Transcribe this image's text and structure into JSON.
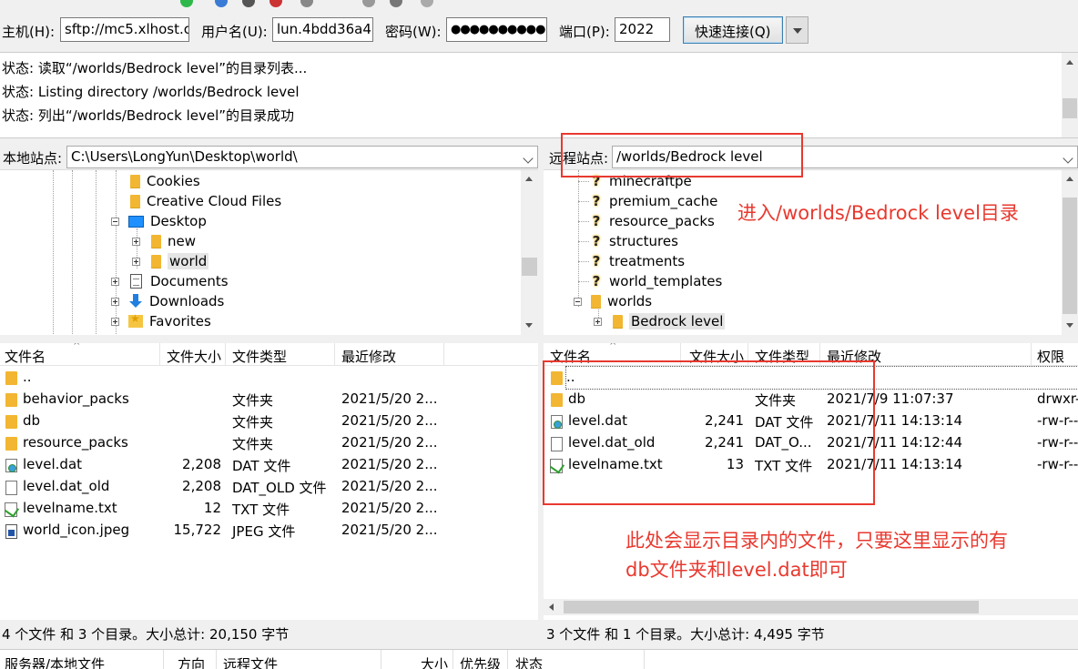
{
  "quickconnect": {
    "host_label": "主机(H):",
    "host_value": "sftp://mc5.xlhost.c",
    "user_label": "用户名(U):",
    "user_value": "lun.4bdd36a4",
    "pass_label": "密码(W):",
    "pass_value": "●●●●●●●●●●",
    "port_label": "端口(P):",
    "port_value": "2022",
    "connect_button": "快速连接(Q)"
  },
  "log": [
    "状态:  读取“/worlds/Bedrock level”的目录列表...",
    "状态:  Listing directory /worlds/Bedrock level",
    "状态:  列出“/worlds/Bedrock level”的目录成功"
  ],
  "local": {
    "site_label": "本地站点:",
    "site_path": "C:\\Users\\LongYun\\Desktop\\world\\",
    "tree": {
      "cookies": "Cookies",
      "creative_cloud": "Creative Cloud Files",
      "desktop": "Desktop",
      "new": "new",
      "world": "world",
      "documents": "Documents",
      "downloads": "Downloads",
      "favorites": "Favorites"
    },
    "columns": {
      "name": "文件名",
      "size": "文件大小",
      "type": "文件类型",
      "modified": "最近修改"
    },
    "files": [
      {
        "name": "..",
        "size": "",
        "type": "",
        "modified": ""
      },
      {
        "name": "behavior_packs",
        "size": "",
        "type": "文件夹",
        "modified": "2021/5/20 2..."
      },
      {
        "name": "db",
        "size": "",
        "type": "文件夹",
        "modified": "2021/5/20 2..."
      },
      {
        "name": "resource_packs",
        "size": "",
        "type": "文件夹",
        "modified": "2021/5/20 2..."
      },
      {
        "name": "level.dat",
        "size": "2,208",
        "type": "DAT 文件",
        "modified": "2021/5/20 2..."
      },
      {
        "name": "level.dat_old",
        "size": "2,208",
        "type": "DAT_OLD 文件",
        "modified": "2021/5/20 2..."
      },
      {
        "name": "levelname.txt",
        "size": "12",
        "type": "TXT 文件",
        "modified": "2021/5/20 2..."
      },
      {
        "name": "world_icon.jpeg",
        "size": "15,722",
        "type": "JPEG 文件",
        "modified": "2021/5/20 2..."
      }
    ],
    "status": "4 个文件 和 3 个目录。大小总计: 20,150 字节"
  },
  "remote": {
    "site_label": "远程站点:",
    "site_path": "/worlds/Bedrock level",
    "tree": {
      "minecraftpe": "minecraftpe",
      "premium_cache": "premium_cache",
      "resource_packs": "resource_packs",
      "structures": "structures",
      "treatments": "treatments",
      "world_templates": "world_templates",
      "worlds": "worlds",
      "bedrock_level": "Bedrock level"
    },
    "columns": {
      "name": "文件名",
      "size": "文件大小",
      "type": "文件类型",
      "modified": "最近修改",
      "perms": "权限"
    },
    "files": [
      {
        "name": "..",
        "size": "",
        "type": "",
        "modified": "",
        "perms": ""
      },
      {
        "name": "db",
        "size": "",
        "type": "文件夹",
        "modified": "2021/7/9 11:07:37",
        "perms": "drwxr-"
      },
      {
        "name": "level.dat",
        "size": "2,241",
        "type": "DAT 文件",
        "modified": "2021/7/11 14:13:14",
        "perms": "-rw-r--"
      },
      {
        "name": "level.dat_old",
        "size": "2,241",
        "type": "DAT_O...",
        "modified": "2021/7/11 14:12:44",
        "perms": "-rw-r--"
      },
      {
        "name": "levelname.txt",
        "size": "13",
        "type": "TXT 文件",
        "modified": "2021/7/11 14:13:14",
        "perms": "-rw-r--"
      }
    ],
    "status": "3 个文件 和 1 个目录。大小总计: 4,495 字节"
  },
  "queue": {
    "col_server": "服务器/本地文件",
    "col_direction": "方向",
    "col_remote": "远程文件",
    "col_size": "大小",
    "col_priority": "优先级",
    "col_status": "状态"
  },
  "annotations": {
    "enter_dir": "进入/worlds/Bedrock level目录",
    "note_line1": "此处会显示目录内的文件，只要这里显示的有",
    "note_line2": "db文件夹和level.dat即可"
  },
  "colors": {
    "annotation": "#e8392f",
    "folder": "#f2b632"
  }
}
